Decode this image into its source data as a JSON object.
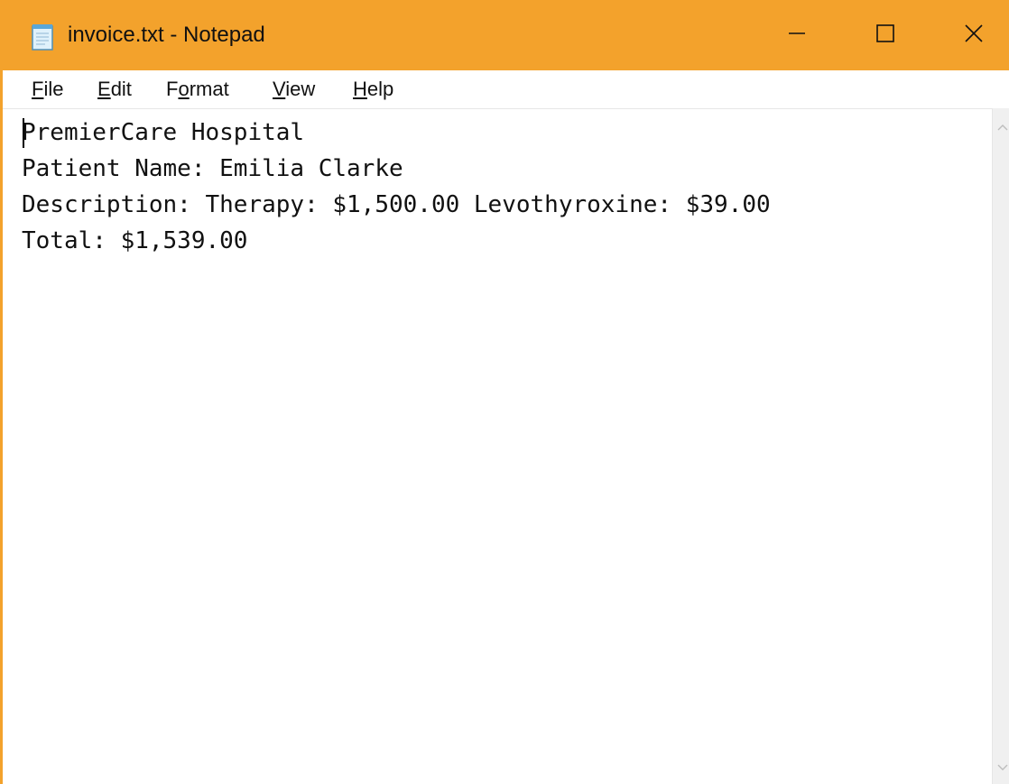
{
  "window": {
    "title": "invoice.txt - Notepad",
    "titlebar_color": "#f3a22c",
    "icon": "notepad-icon",
    "controls": {
      "minimize_icon": "minimize-icon",
      "maximize_icon": "maximize-icon",
      "close_icon": "close-icon"
    }
  },
  "menu": {
    "items": [
      {
        "accel": "F",
        "rest": "ile"
      },
      {
        "accel": "E",
        "rest": "dit"
      },
      {
        "pre": "F",
        "accel": "o",
        "rest": "rmat"
      },
      {
        "accel": "V",
        "rest": "iew"
      },
      {
        "accel": "H",
        "rest": "elp"
      }
    ]
  },
  "document": {
    "text": "PremierCare Hospital\nPatient Name: Emilia Clarke\nDescription: Therapy: $1,500.00 Levothyroxine: $39.00\nTotal: $1,539.00"
  },
  "scrollbar": {
    "up_icon": "scroll-up-arrow-icon",
    "down_icon": "scroll-down-arrow-icon"
  }
}
